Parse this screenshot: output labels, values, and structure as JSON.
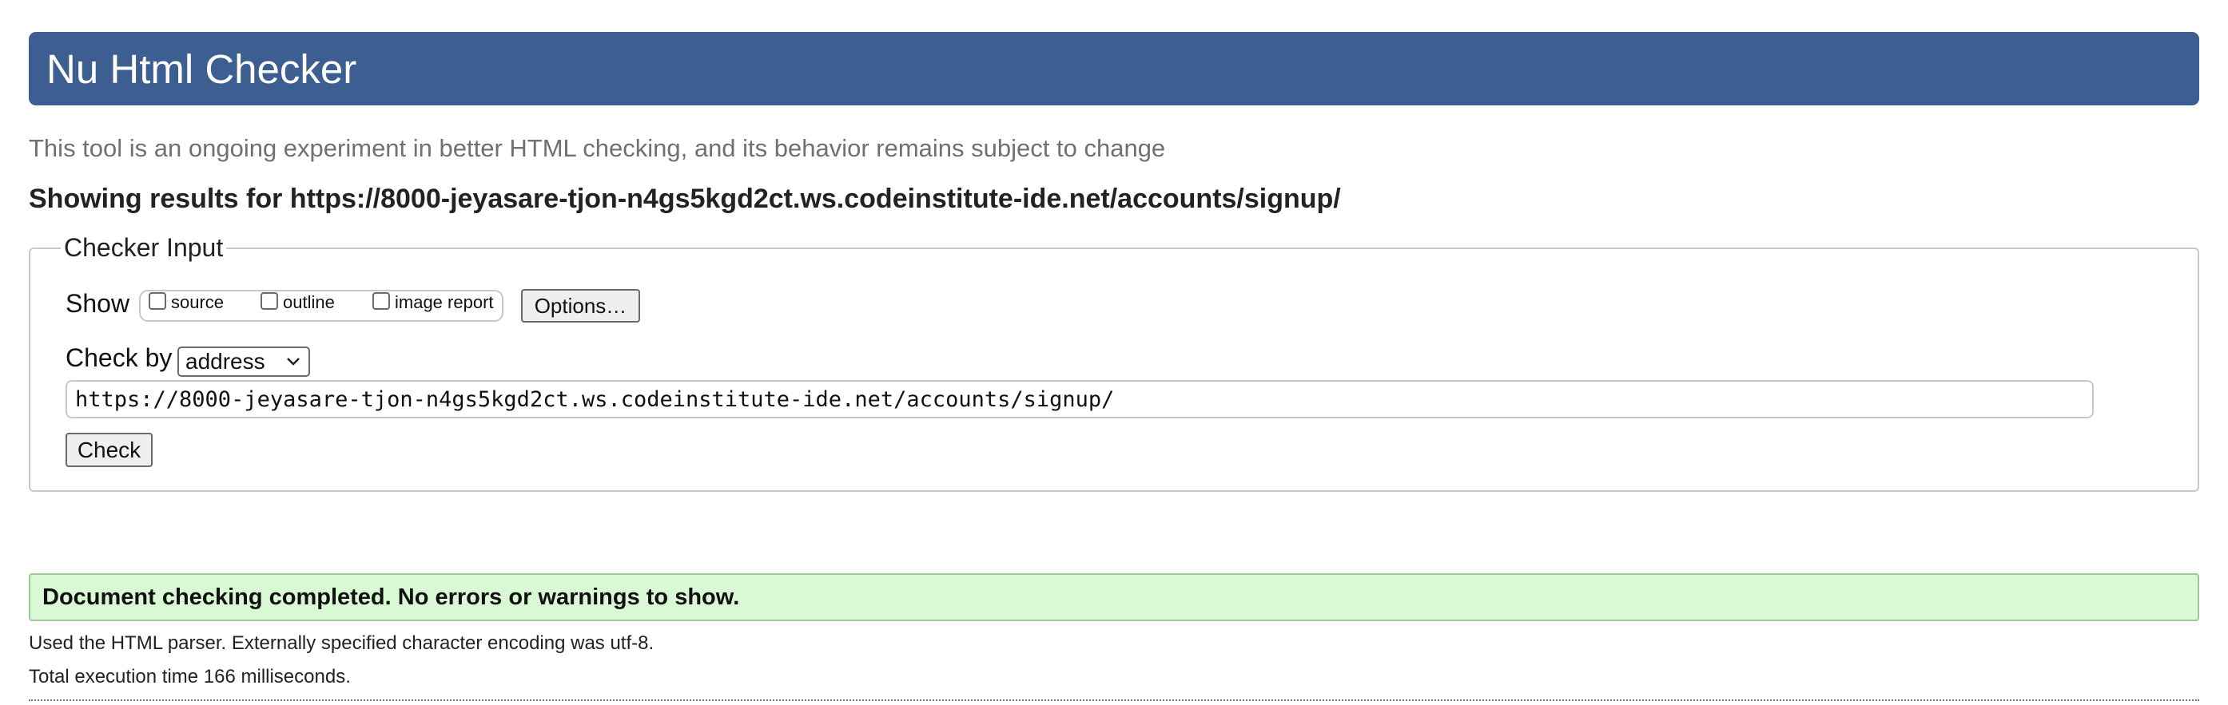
{
  "header": {
    "title": "Nu Html Checker"
  },
  "tagline": "This tool is an ongoing experiment in better HTML checking, and its behavior remains subject to change",
  "results_for": "Showing results for https://8000-jeyasare-tjon-n4gs5kgd2ct.ws.codeinstitute-ide.net/accounts/signup/",
  "checker_input": {
    "legend": "Checker Input",
    "show_label": "Show",
    "show_options": [
      {
        "label": "source",
        "checked": false
      },
      {
        "label": "outline",
        "checked": false
      },
      {
        "label": "image report",
        "checked": false
      }
    ],
    "options_button": "Options…",
    "check_by_label": "Check by",
    "check_by_value": "address",
    "url_value": "https://8000-jeyasare-tjon-n4gs5kgd2ct.ws.codeinstitute-ide.net/accounts/signup/",
    "check_button": "Check"
  },
  "result": {
    "status": "Document checking completed. No errors or warnings to show.",
    "parser_info": "Used the HTML parser. Externally specified character encoding was utf-8.",
    "execution_time": "Total execution time 166 milliseconds."
  },
  "colors": {
    "banner": "#3d5e91",
    "success_bg": "#d9f9d4",
    "success_border": "#9bc79b"
  }
}
